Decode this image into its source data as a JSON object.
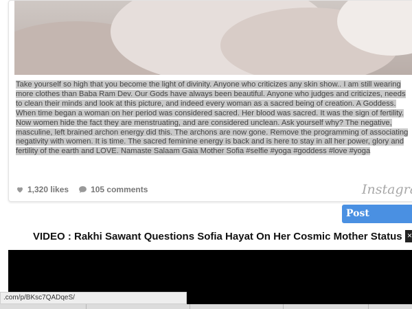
{
  "post": {
    "caption": "Take yourself so high that you become the light of divinity. Anyone who criticizes any skin show.. I am still wearing more clothes than Baba Ram Dev. Our Gods have always been beautiful. Anyone who judges and criticizes, needs to clean their minds and look at this picture, and indeed every woman as a sacred being of creation. A Goddess. When time began a woman on her period was considered sacred. Her blood was sacred. It was the sign of fertility. Now women hide the fact they are menstruating, and are considered unclean. Ask yourself why? The negative, masculine, left brained archon energy did this. The archons are now gone. Remove the programming of associating negativity with women. It is time. The sacred feminine energy is back and is here to stay in all her power, glory and fertility of the earth and LOVE. Namaste Salaam Gaia Mother Sofia #selfie #yoga #goddess #love #yoga",
    "likes": "1,320 likes",
    "comments": "105 comments",
    "brand": "Instagram"
  },
  "post_comment_label": "Post Comment",
  "video": {
    "title": "VIDEO : Rakhi Sawant Questions Sofia Hayat On Her Cosmic Mother Status"
  },
  "status_url": ".com/p/BKsc7QADqeS/"
}
